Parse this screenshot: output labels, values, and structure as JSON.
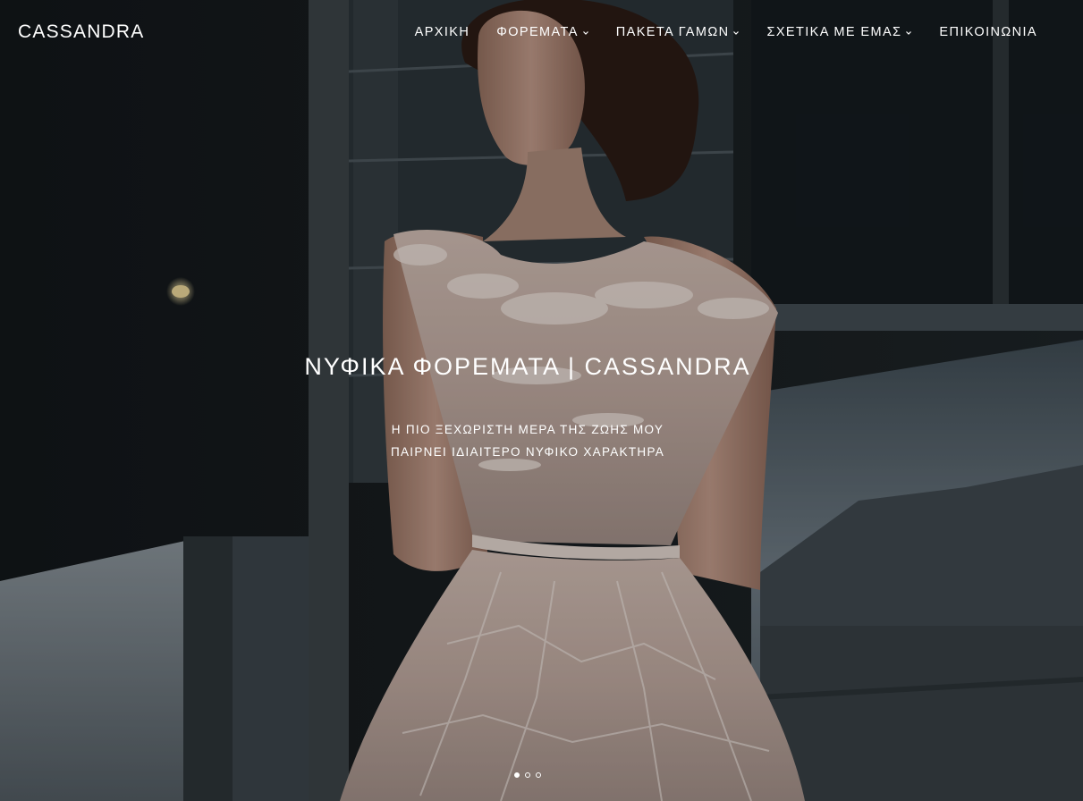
{
  "header": {
    "logo": "CASSANDRA",
    "nav": [
      {
        "label": "ΑΡΧΙΚΗ",
        "has_dropdown": false
      },
      {
        "label": "ΦΟΡΕΜΑΤΑ",
        "has_dropdown": true
      },
      {
        "label": "ΠΑΚΕΤΑ ΓΑΜΩΝ",
        "has_dropdown": true
      },
      {
        "label": "ΣΧΕΤΙΚΑ ΜΕ ΕΜΑΣ",
        "has_dropdown": true
      },
      {
        "label": "ΕΠΙΚΟΙΝΩΝΙΑ",
        "has_dropdown": false
      }
    ]
  },
  "hero": {
    "title": "ΝΥΦΙΚΑ ΦΟΡΕΜΑΤΑ | CASSANDRA",
    "subtitle_line1": "Η ΠΙΟ ΞΕΧΩΡΙΣΤΗ ΜΕΡΑ ΤΗΣ ΖΩΗΣ ΜΟΥ",
    "subtitle_line2": "ΠΑΙΡΝΕΙ ΙΔΙΑΙΤΕΡΟ ΝΥΦΙΚΟ ΧΑΡΑΚΤΗΡΑ",
    "image": "bride-in-lace-wedding-dress-photo"
  },
  "slider": {
    "slide_count": 3,
    "active_index": 0
  },
  "colors": {
    "text": "#ffffff",
    "background_dark": "#1a1d20"
  }
}
